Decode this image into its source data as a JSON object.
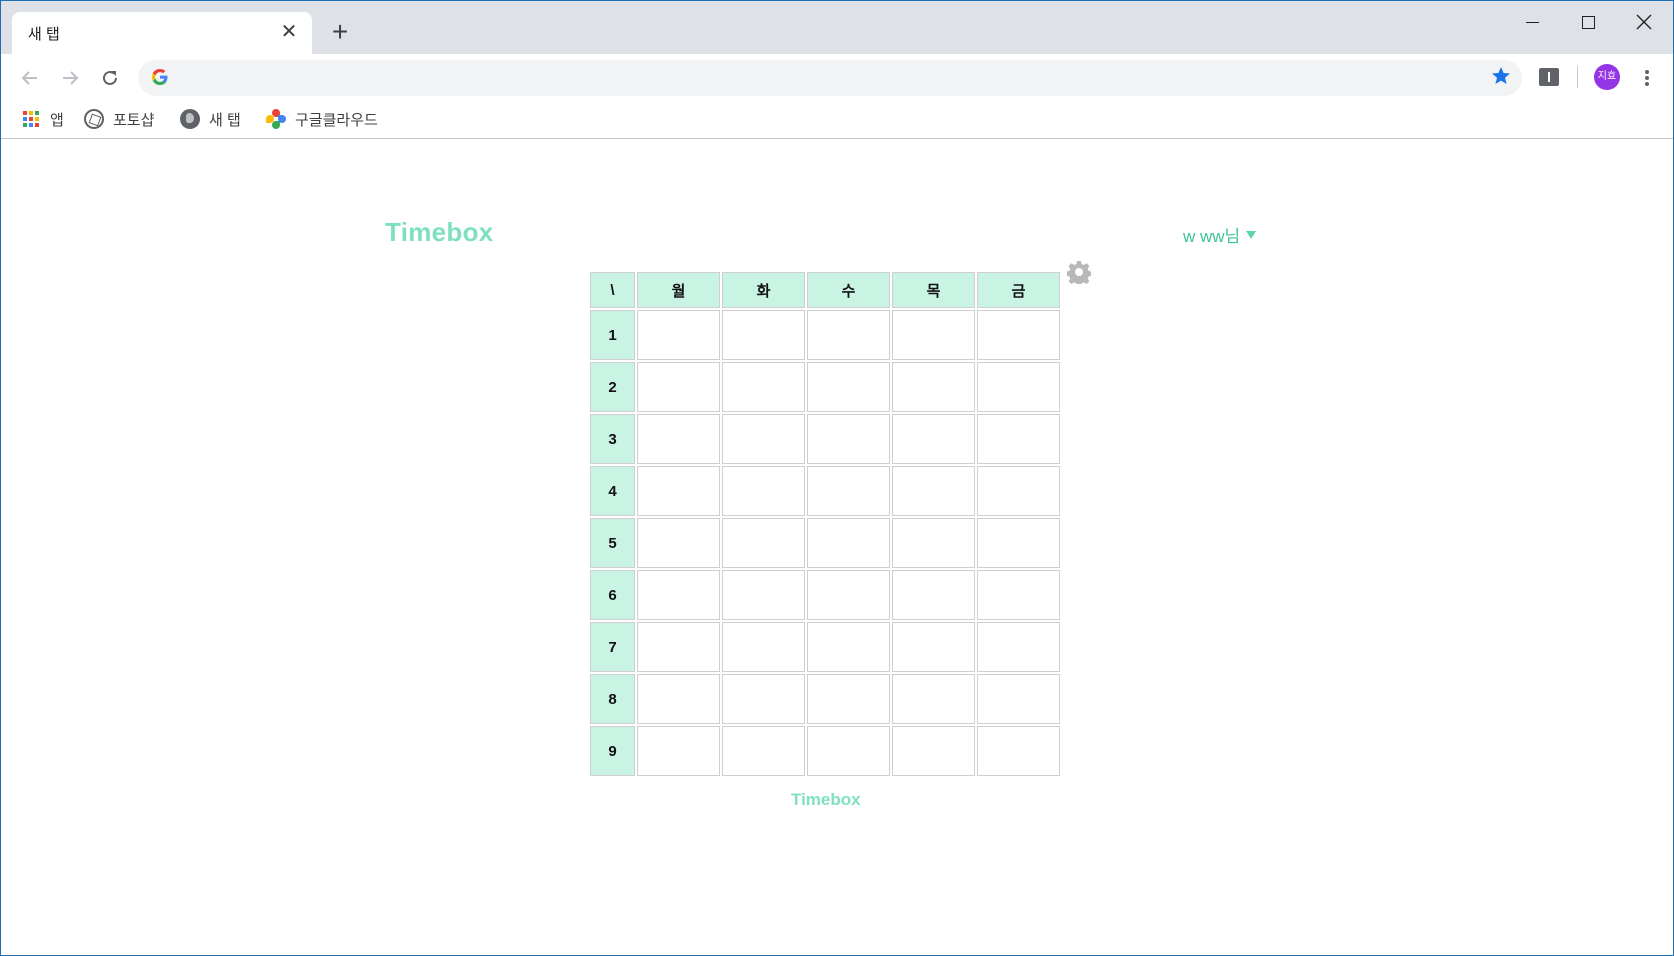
{
  "browser": {
    "tab_title": "새 탭",
    "tab_close": "✕",
    "new_tab": "+",
    "avatar_text": "지효",
    "bookmarks": [
      {
        "label": "앱",
        "icon": "apps-grid-icon"
      },
      {
        "label": "포토샵",
        "icon": "aperture-icon"
      },
      {
        "label": "새 탭",
        "icon": "globe-icon"
      },
      {
        "label": "구글클라우드",
        "icon": "pinwheel-icon"
      }
    ]
  },
  "page": {
    "brand": "Timebox",
    "user_name": "w ww님",
    "footer_brand": "Timebox"
  },
  "timetable": {
    "corner": "\\",
    "days": [
      "월",
      "화",
      "수",
      "목",
      "금"
    ],
    "rows": [
      "1",
      "2",
      "3",
      "4",
      "5",
      "6",
      "7",
      "8",
      "9"
    ]
  },
  "colors": {
    "accent": "#7fe0c0",
    "header_bg": "#c9f4e4",
    "user_text": "#3cc39a",
    "avatar_bg": "#9334e6",
    "star": "#1a73e8"
  }
}
